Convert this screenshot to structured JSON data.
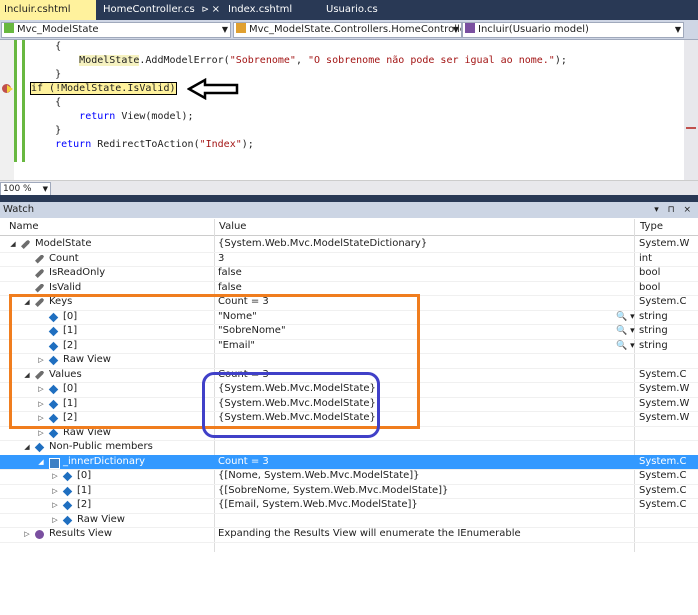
{
  "tabs": [
    {
      "label": "Incluir.cshtml",
      "active": true
    },
    {
      "label": "HomeController.cs",
      "active": false,
      "pin": "⊳",
      "close": "×"
    },
    {
      "label": "Index.cshtml",
      "active": false
    },
    {
      "label": "Usuario.cs",
      "active": false
    }
  ],
  "navbar": {
    "project": "Mvc_ModelState",
    "class": "Mvc_ModelState.Controllers.HomeControlle",
    "member": "Incluir(Usuario model)"
  },
  "code": [
    {
      "parts": [
        {
          "t": "    {",
          "c": ""
        }
      ]
    },
    {
      "parts": [
        {
          "t": "        ",
          "c": ""
        },
        {
          "t": "ModelState",
          "c": "hlw"
        },
        {
          "t": ".AddModelError(",
          "c": ""
        },
        {
          "t": "\"Sobrenome\"",
          "c": "st"
        },
        {
          "t": ", ",
          "c": ""
        },
        {
          "t": "\"O sobrenome não pode ser igual ao nome.\"",
          "c": "st"
        },
        {
          "t": ");",
          "c": ""
        }
      ]
    },
    {
      "parts": [
        {
          "t": "    }",
          "c": ""
        }
      ]
    },
    {
      "parts": [
        {
          "t": "if (!ModelState.IsValid)",
          "c": "hl"
        }
      ]
    },
    {
      "parts": [
        {
          "t": "    {",
          "c": ""
        }
      ]
    },
    {
      "parts": [
        {
          "t": "        ",
          "c": ""
        },
        {
          "t": "return",
          "c": "kw"
        },
        {
          "t": " View(model);",
          "c": ""
        }
      ]
    },
    {
      "parts": [
        {
          "t": "    }",
          "c": ""
        }
      ]
    },
    {
      "parts": [
        {
          "t": "    ",
          "c": ""
        },
        {
          "t": "return",
          "c": "kw"
        },
        {
          "t": " RedirectToAction(",
          "c": ""
        },
        {
          "t": "\"Index\"",
          "c": "st"
        },
        {
          "t": ");",
          "c": ""
        }
      ]
    }
  ],
  "zoom": "100 %",
  "watch": {
    "title": "Watch",
    "buttons": "▾ ⊓ ×",
    "columns": {
      "name": "Name",
      "value": "Value",
      "type": "Type"
    },
    "rows": [
      {
        "lvl": 0,
        "exp": "◢",
        "ico": "wrench",
        "name": "ModelState",
        "value": "{System.Web.Mvc.ModelStateDictionary}",
        "type": "System.W"
      },
      {
        "lvl": 1,
        "exp": "",
        "ico": "wrench",
        "name": "Count",
        "value": "3",
        "type": "int"
      },
      {
        "lvl": 1,
        "exp": "",
        "ico": "wrench",
        "name": "IsReadOnly",
        "value": "false",
        "type": "bool"
      },
      {
        "lvl": 1,
        "exp": "",
        "ico": "wrench",
        "name": "IsValid",
        "value": "false",
        "type": "bool"
      },
      {
        "lvl": 1,
        "exp": "◢",
        "ico": "wrench",
        "name": "Keys",
        "value": "Count = 3",
        "type": "System.C"
      },
      {
        "lvl": 2,
        "exp": "",
        "ico": "cube",
        "name": "[0]",
        "value": "\"Nome\"",
        "type": "string",
        "mag": "🔍 ▾"
      },
      {
        "lvl": 2,
        "exp": "",
        "ico": "cube",
        "name": "[1]",
        "value": "\"SobreNome\"",
        "type": "string",
        "mag": "🔍 ▾"
      },
      {
        "lvl": 2,
        "exp": "",
        "ico": "cube",
        "name": "[2]",
        "value": "\"Email\"",
        "type": "string",
        "mag": "🔍 ▾"
      },
      {
        "lvl": 2,
        "exp": "▷",
        "ico": "cube",
        "name": "Raw View",
        "value": "",
        "type": ""
      },
      {
        "lvl": 1,
        "exp": "◢",
        "ico": "wrench",
        "name": "Values",
        "value": "Count = 3",
        "type": "System.C"
      },
      {
        "lvl": 2,
        "exp": "▷",
        "ico": "cube",
        "name": "[0]",
        "value": "{System.Web.Mvc.ModelState}",
        "type": "System.W"
      },
      {
        "lvl": 2,
        "exp": "▷",
        "ico": "cube",
        "name": "[1]",
        "value": "{System.Web.Mvc.ModelState}",
        "type": "System.W"
      },
      {
        "lvl": 2,
        "exp": "▷",
        "ico": "cube",
        "name": "[2]",
        "value": "{System.Web.Mvc.ModelState}",
        "type": "System.W"
      },
      {
        "lvl": 2,
        "exp": "▷",
        "ico": "cube",
        "name": "Raw View",
        "value": "",
        "type": ""
      },
      {
        "lvl": 1,
        "exp": "◢",
        "ico": "cube",
        "name": "Non-Public members",
        "value": "",
        "type": ""
      },
      {
        "lvl": 2,
        "exp": "◢",
        "ico": "lock",
        "name": "_innerDictionary",
        "value": "Count = 3",
        "type": "System.C",
        "sel": true
      },
      {
        "lvl": 3,
        "exp": "▷",
        "ico": "cube",
        "name": "[0]",
        "value": "{[Nome, System.Web.Mvc.ModelState]}",
        "type": "System.C"
      },
      {
        "lvl": 3,
        "exp": "▷",
        "ico": "cube",
        "name": "[1]",
        "value": "{[SobreNome, System.Web.Mvc.ModelState]}",
        "type": "System.C"
      },
      {
        "lvl": 3,
        "exp": "▷",
        "ico": "cube",
        "name": "[2]",
        "value": "{[Email, System.Web.Mvc.ModelState]}",
        "type": "System.C"
      },
      {
        "lvl": 3,
        "exp": "▷",
        "ico": "cube",
        "name": "Raw View",
        "value": "",
        "type": ""
      },
      {
        "lvl": 1,
        "exp": "▷",
        "ico": "gear",
        "name": "Results View",
        "value": "Expanding the Results View will enumerate the IEnumerable",
        "type": ""
      }
    ]
  }
}
